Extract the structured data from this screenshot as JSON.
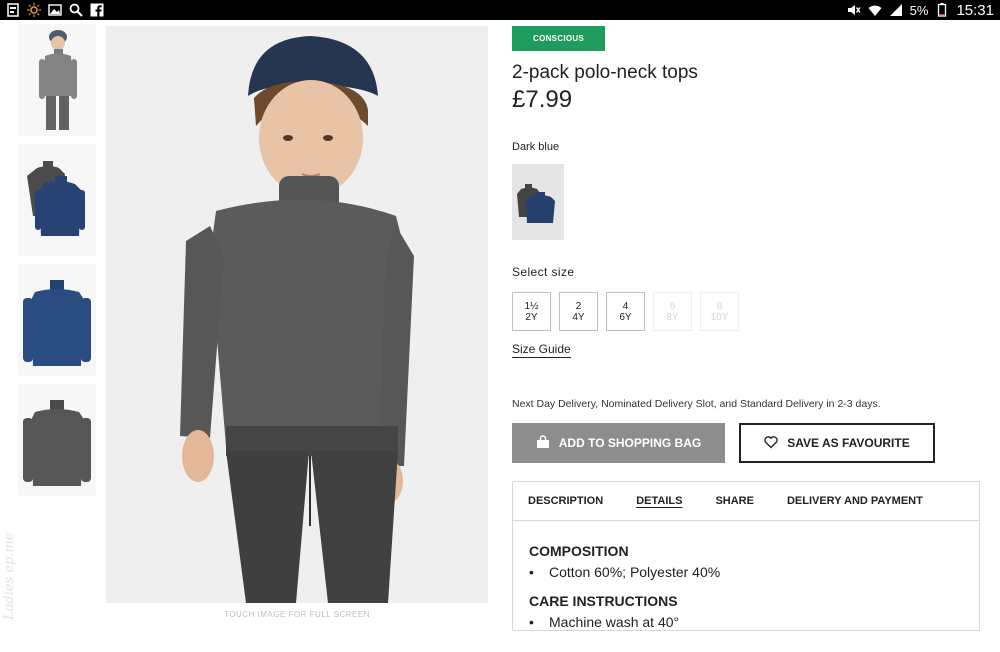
{
  "status_bar": {
    "battery": "5%",
    "time": "15:31"
  },
  "gallery": {
    "thumbnails": [
      "boy-model",
      "two-tops",
      "dark-blue-top",
      "dark-grey-top"
    ],
    "fullscreen_hint": "TOUCH IMAGE FOR FULL SCREEN",
    "watermark": "Ladies ep.me"
  },
  "product": {
    "badge": "CONSCIOUS",
    "badge_color": "#1f9b5d",
    "title": "2-pack polo-neck tops",
    "price": "£7.99",
    "color_name": "Dark blue",
    "size_label": "Select size",
    "sizes": [
      {
        "line1": "1½",
        "line2": "2Y",
        "available": true
      },
      {
        "line1": "2",
        "line2": "4Y",
        "available": true
      },
      {
        "line1": "4",
        "line2": "6Y",
        "available": true
      },
      {
        "line1": "6",
        "line2": "8Y",
        "available": false
      },
      {
        "line1": "8",
        "line2": "10Y",
        "available": false
      }
    ],
    "size_guide": "Size Guide",
    "delivery": "Next Day Delivery, Nominated Delivery Slot, and Standard Delivery in 2-3 days.",
    "add_to_bag": "ADD TO SHOPPING BAG",
    "save_favourite": "SAVE AS FAVOURITE"
  },
  "tabs": [
    "DESCRIPTION",
    "DETAILS",
    "SHARE",
    "DELIVERY AND PAYMENT"
  ],
  "active_tab": "DETAILS",
  "details": {
    "composition_title": "COMPOSITION",
    "composition_item": "Cotton 60%; Polyester 40%",
    "care_title": "CARE INSTRUCTIONS",
    "care_item": "Machine wash at 40°"
  }
}
